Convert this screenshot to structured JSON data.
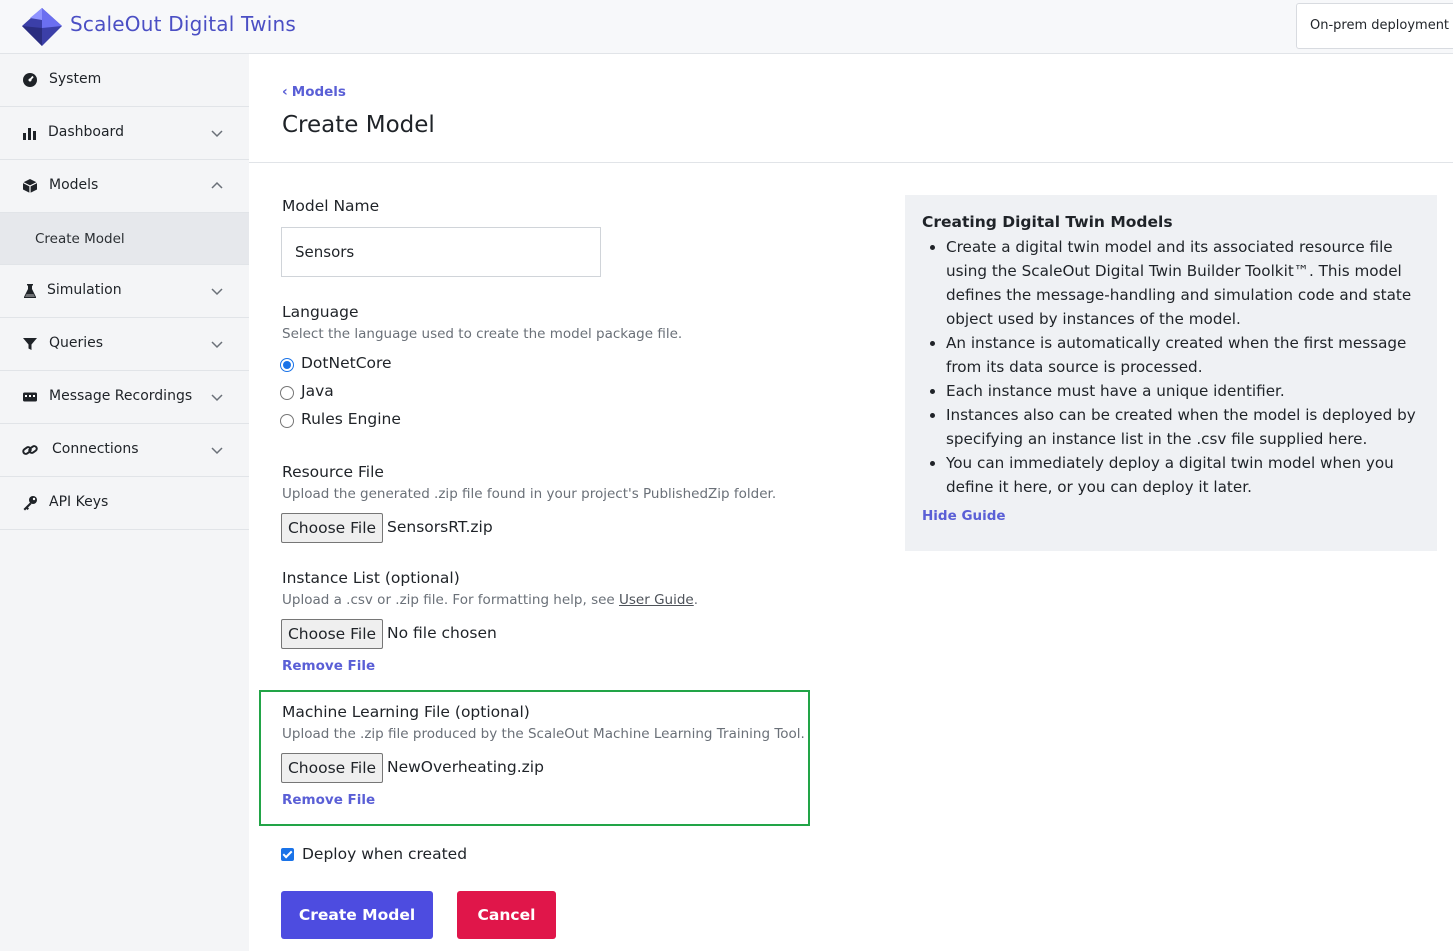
{
  "app": {
    "title": "ScaleOut Digital Twins",
    "deployment": "On-prem deployment"
  },
  "sidebar": {
    "items": [
      {
        "label": "System",
        "icon": "gauge-icon"
      },
      {
        "label": "Dashboard",
        "icon": "bar-chart-icon"
      },
      {
        "label": "Models",
        "icon": "cube-icon"
      },
      {
        "label": "Create Model"
      },
      {
        "label": "Simulation",
        "icon": "flask-icon"
      },
      {
        "label": "Queries",
        "icon": "funnel-icon"
      },
      {
        "label": "Message Recordings",
        "icon": "recording-icon"
      },
      {
        "label": "Connections",
        "icon": "link-icon"
      },
      {
        "label": "API Keys",
        "icon": "key-icon"
      }
    ]
  },
  "main": {
    "breadcrumb": "Models",
    "title": "Create Model",
    "model_name": {
      "label": "Model Name",
      "value": "Sensors"
    },
    "language": {
      "label": "Language",
      "help": "Select the language used to create the model package file.",
      "options": [
        "DotNetCore",
        "Java",
        "Rules Engine"
      ],
      "selected": "DotNetCore"
    },
    "resource_file": {
      "label": "Resource File",
      "help": "Upload the generated .zip file found in your project's PublishedZip folder.",
      "button": "Choose File",
      "file": "SensorsRT.zip"
    },
    "instance_list": {
      "label": "Instance List (optional)",
      "help_prefix": "Upload a .csv or .zip file. For formatting help, see ",
      "help_link": "User Guide",
      "help_suffix": ".",
      "button": "Choose File",
      "file": "No file chosen",
      "remove": "Remove File"
    },
    "ml_file": {
      "label": "Machine Learning File (optional)",
      "help": "Upload the .zip file produced by the ScaleOut Machine Learning Training Tool.",
      "button": "Choose File",
      "file": "NewOverheating.zip",
      "remove": "Remove File"
    },
    "deploy": {
      "label": "Deploy when created",
      "checked": true
    },
    "create_button": "Create Model",
    "cancel_button": "Cancel"
  },
  "guide": {
    "title": "Creating Digital Twin Models",
    "items": [
      "Create a digital twin model and its associated resource file using the ScaleOut Digital Twin Builder Toolkit™. This model defines the message-handling and simulation code and state object used by instances of the model.",
      "An instance is automatically created when the first message from its data source is processed.",
      "Each instance must have a unique identifier.",
      "Instances also can be created when the model is deployed by specifying an instance list in the .csv file supplied here.",
      "You can immediately deploy a digital twin model when you define it here, or you can deploy it later."
    ],
    "hide": "Hide Guide"
  },
  "colors": {
    "accent": "#4d4ce0",
    "danger": "#e0164a",
    "link": "#5a5fd6",
    "highlight": "#22a447"
  }
}
